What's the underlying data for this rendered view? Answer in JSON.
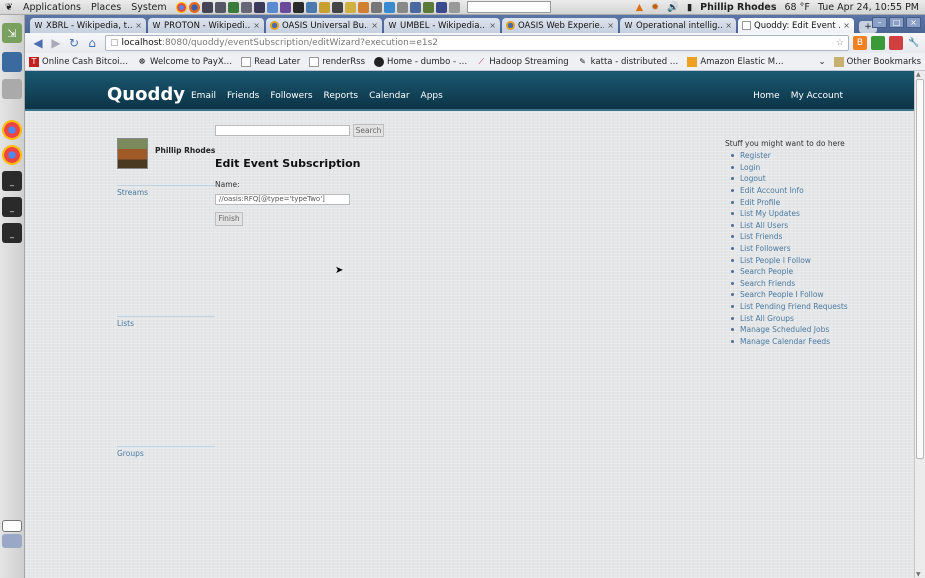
{
  "panel": {
    "menus": [
      "Applications",
      "Places",
      "System"
    ],
    "user": "Phillip Rhodes",
    "weather": "68 °F",
    "clock": "Tue Apr 24, 10:55 PM"
  },
  "browser": {
    "tabs": [
      {
        "title": "XBRL - Wikipedia, t…",
        "favicon": "W"
      },
      {
        "title": "PROTON - Wikipedi…",
        "favicon": "W"
      },
      {
        "title": "OASIS Universal Bu…",
        "favicon": "oasis"
      },
      {
        "title": "UMBEL - Wikipedia…",
        "favicon": "W"
      },
      {
        "title": "OASIS Web Experie…",
        "favicon": "oasis"
      },
      {
        "title": "Operational intellig…",
        "favicon": "W"
      },
      {
        "title": "Quoddy: Edit Event …",
        "favicon": "page",
        "active": true
      }
    ],
    "url": {
      "host": "localhost",
      "path": ":8080/quoddy/eventSubscription/editWizard?execution=e1s2"
    },
    "bookmarks": [
      {
        "label": "Online Cash Bitcoi…",
        "icon": "T"
      },
      {
        "label": "Welcome to PayX…",
        "icon": "pay"
      },
      {
        "label": "Read Later",
        "icon": "page"
      },
      {
        "label": "renderRss",
        "icon": "page"
      },
      {
        "label": "Home - dumbo - …",
        "icon": "github"
      },
      {
        "label": "Hadoop Streaming",
        "icon": "feather"
      },
      {
        "label": "katta - distributed …",
        "icon": "katta"
      },
      {
        "label": "Amazon Elastic M…",
        "icon": "aws"
      }
    ],
    "other_bookmarks": "Other Bookmarks"
  },
  "site": {
    "brand": "Quoddy",
    "nav": [
      "Email",
      "Friends",
      "Followers",
      "Reports",
      "Calendar",
      "Apps"
    ],
    "nav_right": [
      "Home",
      "My Account"
    ],
    "search_button": "Search",
    "user_name": "Phillip Rhodes",
    "sidebar": [
      "Streams",
      "Lists",
      "Groups"
    ],
    "form": {
      "title": "Edit Event Subscription",
      "name_label": "Name:",
      "name_value": "//oasis:RFQ[@type='typeTwo']",
      "finish_button": "Finish"
    },
    "stuff_title": "Stuff you might want to do here",
    "stuff_links": [
      "Register",
      "Login",
      "Logout",
      "Edit Account Info",
      "Edit Profile",
      "List My Updates",
      "List All Users",
      "List Friends",
      "List Followers",
      "List People I Follow",
      "Search People",
      "Search Friends",
      "Search People I Follow",
      "List Pending Friend Requests",
      "List All Groups",
      "Manage Scheduled Jobs",
      "Manage Calendar Feeds"
    ]
  },
  "colors": {
    "header": "#154b61",
    "link": "#4a7aa0",
    "tabstrip": "#5070a0"
  }
}
